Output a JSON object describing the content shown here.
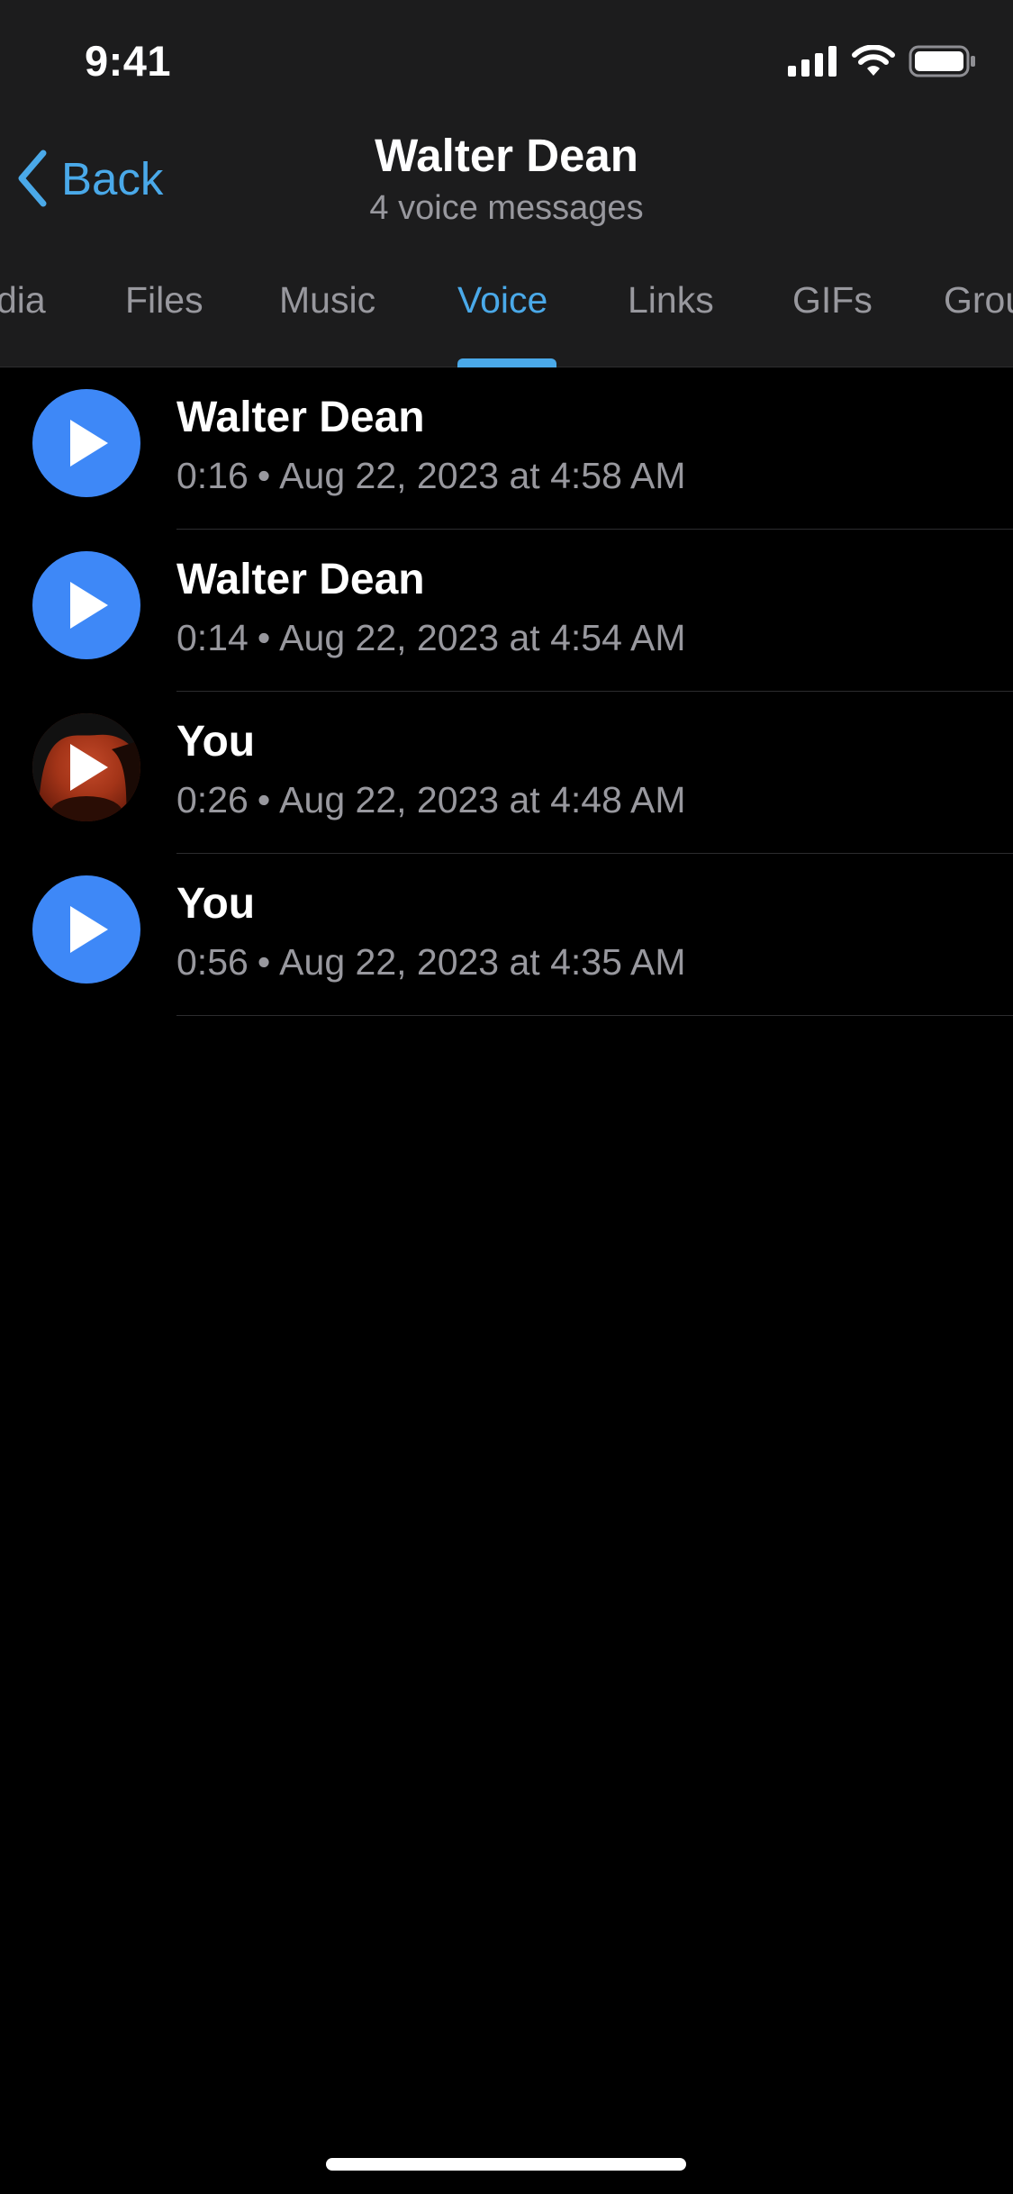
{
  "status_bar": {
    "time": "9:41"
  },
  "nav": {
    "back_label": "Back",
    "title": "Walter Dean",
    "subtitle": "4 voice messages"
  },
  "tabs": [
    {
      "label": "dia",
      "active": false
    },
    {
      "label": "Files",
      "active": false
    },
    {
      "label": "Music",
      "active": false
    },
    {
      "label": "Voice",
      "active": true
    },
    {
      "label": "Links",
      "active": false
    },
    {
      "label": "GIFs",
      "active": false
    },
    {
      "label": "Grou",
      "active": false
    }
  ],
  "messages": [
    {
      "sender": "Walter Dean",
      "duration": "0:16",
      "separator": "•",
      "timestamp": "Aug 22, 2023 at 4:58 AM",
      "avatar": "play-icon"
    },
    {
      "sender": "Walter Dean",
      "duration": "0:14",
      "separator": "•",
      "timestamp": "Aug 22, 2023 at 4:54 AM",
      "avatar": "play-icon"
    },
    {
      "sender": "You",
      "duration": "0:26",
      "separator": "•",
      "timestamp": "Aug 22, 2023 at 4:48 AM",
      "avatar": "profile-photo"
    },
    {
      "sender": "You",
      "duration": "0:56",
      "separator": "•",
      "timestamp": "Aug 22, 2023 at 4:35 AM",
      "avatar": "play-icon"
    }
  ],
  "colors": {
    "accent": "#4aa9e9",
    "play_button": "#3e88f7",
    "header_bg": "#1c1c1d",
    "secondary_text": "#98989e"
  }
}
